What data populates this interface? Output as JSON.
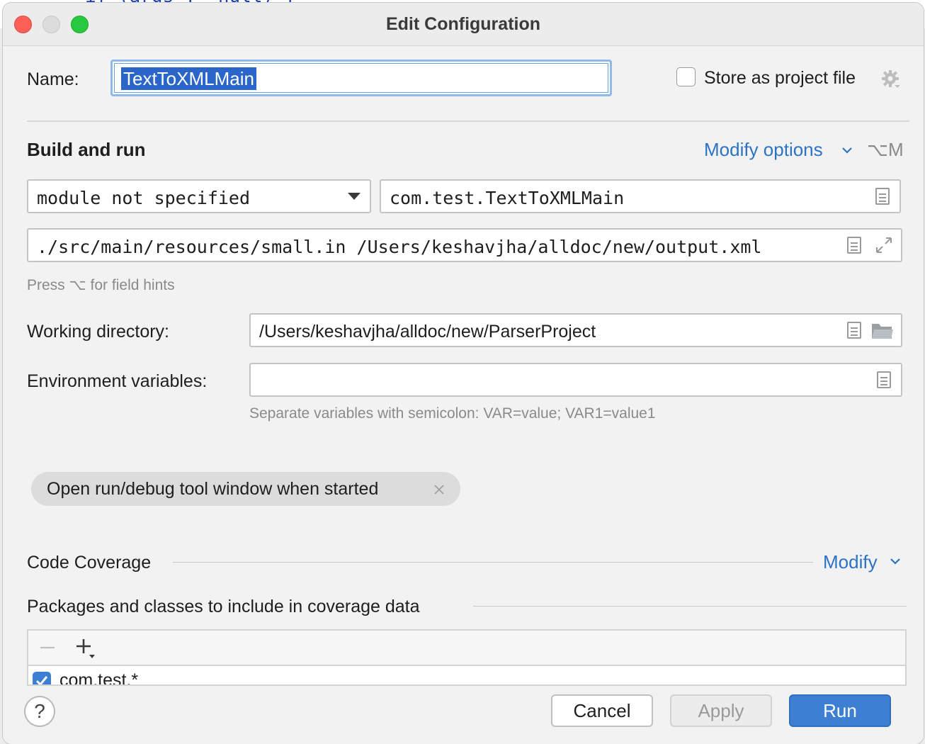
{
  "background_code": "if (args != null) {",
  "window": {
    "title": "Edit Configuration"
  },
  "name_row": {
    "label": "Name:",
    "value": "TextToXMLMain",
    "store_label": "Store as project file",
    "store_checked": false
  },
  "build_run": {
    "title": "Build and run",
    "modify_options": "Modify options",
    "shortcut": "⌥M",
    "module": "module not specified",
    "main_class": "com.test.TextToXMLMain",
    "program_args": "./src/main/resources/small.in /Users/keshavjha/alldoc/new/output.xml",
    "field_hint": "Press ⌥ for field hints"
  },
  "working_dir": {
    "label": "Working directory:",
    "value": "/Users/keshavjha/alldoc/new/ParserProject"
  },
  "env_vars": {
    "label": "Environment variables:",
    "value": "",
    "hint": "Separate variables with semicolon: VAR=value; VAR1=value1"
  },
  "option_chip": {
    "label": "Open run/debug tool window when started"
  },
  "coverage": {
    "title": "Code Coverage",
    "modify": "Modify",
    "packages_title": "Packages and classes to include in coverage data",
    "first_entry": "com.test.*",
    "first_entry_checked": true
  },
  "buttons": {
    "help": "?",
    "cancel": "Cancel",
    "apply": "Apply",
    "run": "Run"
  },
  "colors": {
    "accent": "#3d7fd2",
    "link": "#2d73c4",
    "selection": "#2a66c9"
  }
}
